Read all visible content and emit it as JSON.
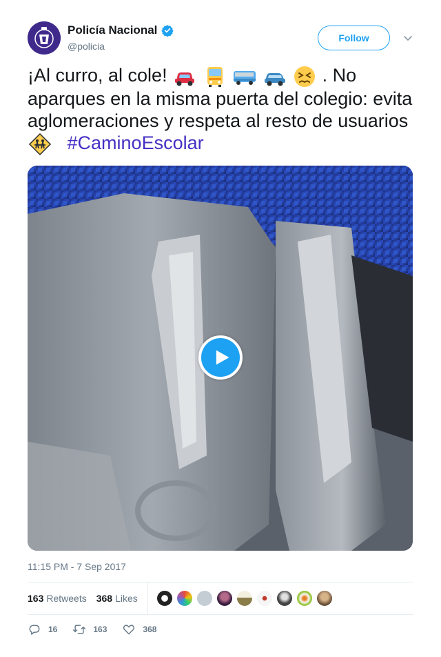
{
  "account": {
    "display_name": "Policía Nacional",
    "handle": "@policia",
    "verified": true,
    "avatar_color": "#3f2a8c"
  },
  "header": {
    "follow_label": "Follow"
  },
  "tweet": {
    "text_part1": "¡Al curro, al cole!",
    "text_part2": ". No aparques en la misma puerta del colegio: evita aglomeraciones y respeta al resto de usuarios",
    "hashtag": "#CaminoEscolar",
    "emojis": [
      "car-emoji",
      "bus-front-emoji",
      "bus-emoji",
      "car-side-emoji",
      "persevering-face-emoji",
      "children-crossing-emoji"
    ]
  },
  "media": {
    "type": "video",
    "play_icon": "play-icon"
  },
  "timestamp": "11:15 PM - 7 Sep 2017",
  "stats": {
    "retweets_count": "163",
    "retweets_label": "Retweets",
    "likes_count": "368",
    "likes_label": "Likes",
    "liker_avatars": 9
  },
  "actions": {
    "reply_count": "16",
    "retweet_count": "163",
    "like_count": "368"
  },
  "colors": {
    "accent": "#1da1f2",
    "hashtag": "#4530c4",
    "muted": "#657786"
  }
}
